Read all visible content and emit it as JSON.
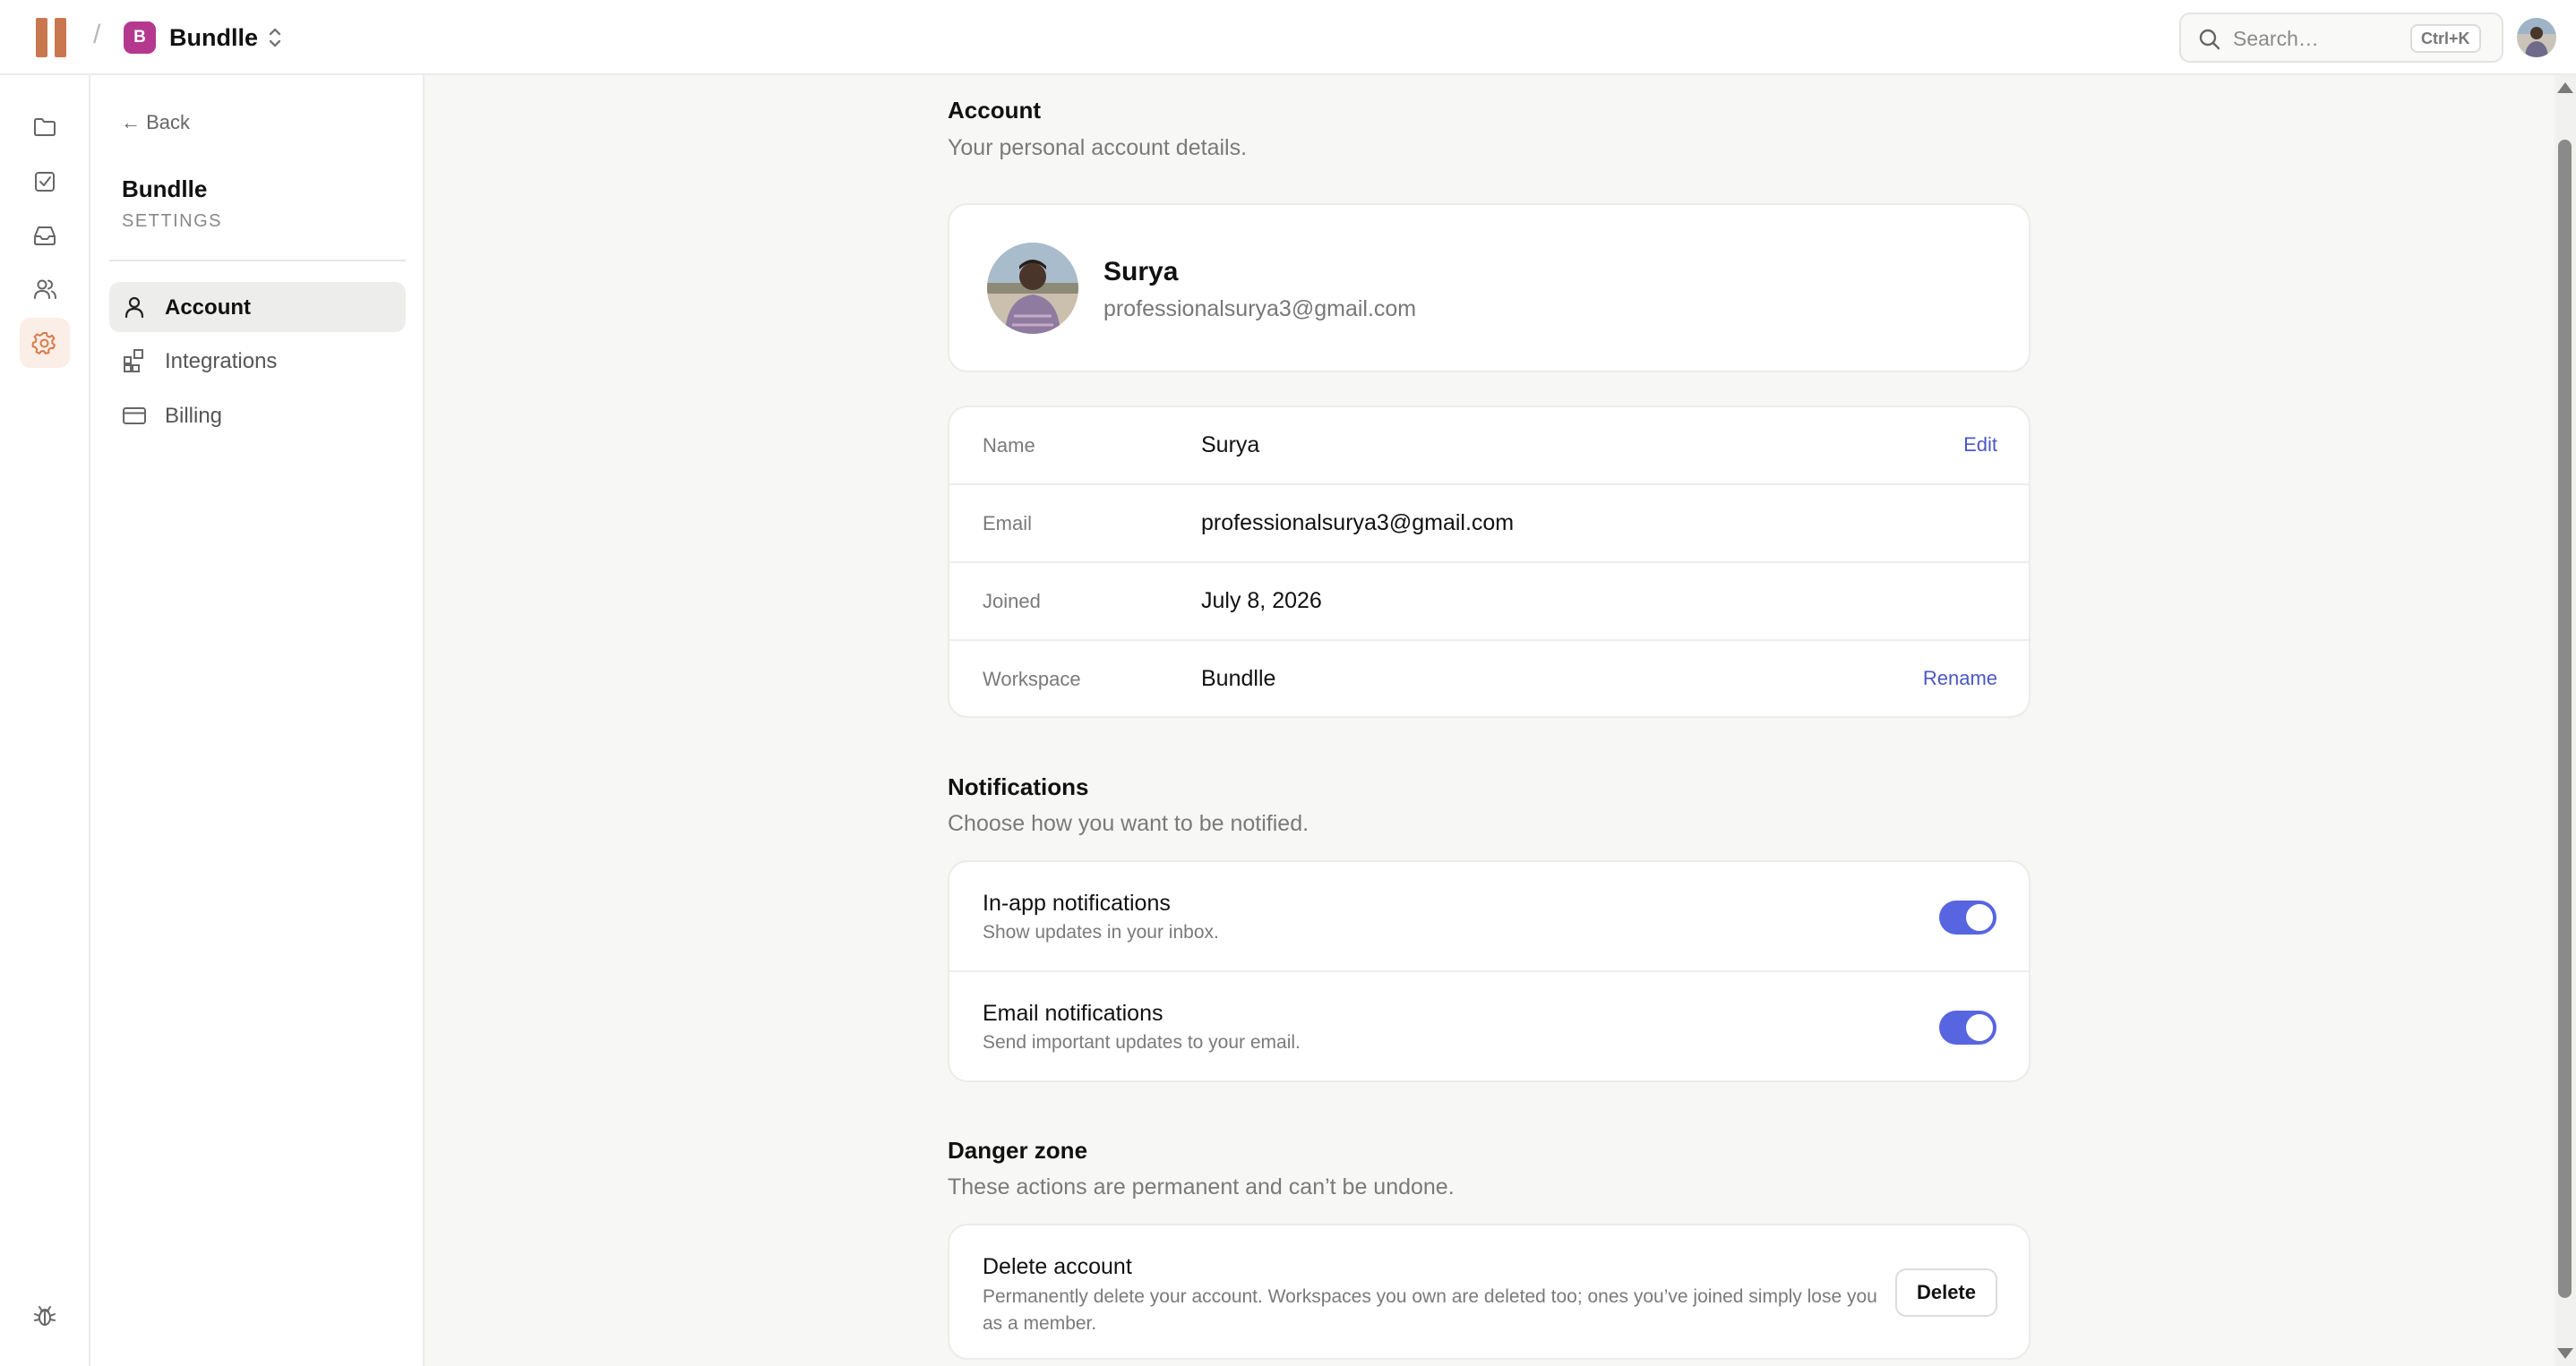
{
  "topbar": {
    "separator": "/",
    "workspace_initial": "B",
    "workspace_name": "Bundlle",
    "search_placeholder": "Search…",
    "search_shortcut": "Ctrl+K"
  },
  "rail": {
    "items": [
      "folder-icon",
      "check-square-icon",
      "inbox-icon",
      "users-icon",
      "gear-icon"
    ],
    "active": "gear-icon",
    "bottom": "bug-icon"
  },
  "sidebar": {
    "back_label": "← Back",
    "title": "Bundlle",
    "subtitle": "SETTINGS",
    "items": [
      {
        "label": "Account",
        "icon": "user-icon",
        "active": true
      },
      {
        "label": "Integrations",
        "icon": "grid-plus-icon",
        "active": false
      },
      {
        "label": "Billing",
        "icon": "credit-card-icon",
        "active": false
      }
    ]
  },
  "account": {
    "title": "Account",
    "subtitle": "Your personal account details.",
    "profile_name": "Surya",
    "profile_email": "professionalsurya3@gmail.com",
    "rows": [
      {
        "label": "Name",
        "value": "Surya",
        "action": "Edit"
      },
      {
        "label": "Email",
        "value": "professionalsurya3@gmail.com",
        "action": ""
      },
      {
        "label": "Joined",
        "value": "July 8, 2026",
        "action": ""
      },
      {
        "label": "Workspace",
        "value": "Bundlle",
        "action": "Rename"
      }
    ]
  },
  "notifications": {
    "title": "Notifications",
    "subtitle": "Choose how you want to be notified.",
    "items": [
      {
        "title": "In-app notifications",
        "desc": "Show updates in your inbox.",
        "enabled": true
      },
      {
        "title": "Email notifications",
        "desc": "Send important updates to your email.",
        "enabled": true
      }
    ]
  },
  "danger": {
    "title": "Danger zone",
    "subtitle": "These actions are permanent and can’t be undone.",
    "item_title": "Delete account",
    "item_desc": "Permanently delete your account. Workspaces you own are deleted too; ones you’ve joined simply lose you as a member.",
    "button": "Delete"
  },
  "colors": {
    "accent": "#5865e0",
    "link": "#4b57c4",
    "brand": "#c9774f",
    "workspace_badge": "#b5388f"
  }
}
